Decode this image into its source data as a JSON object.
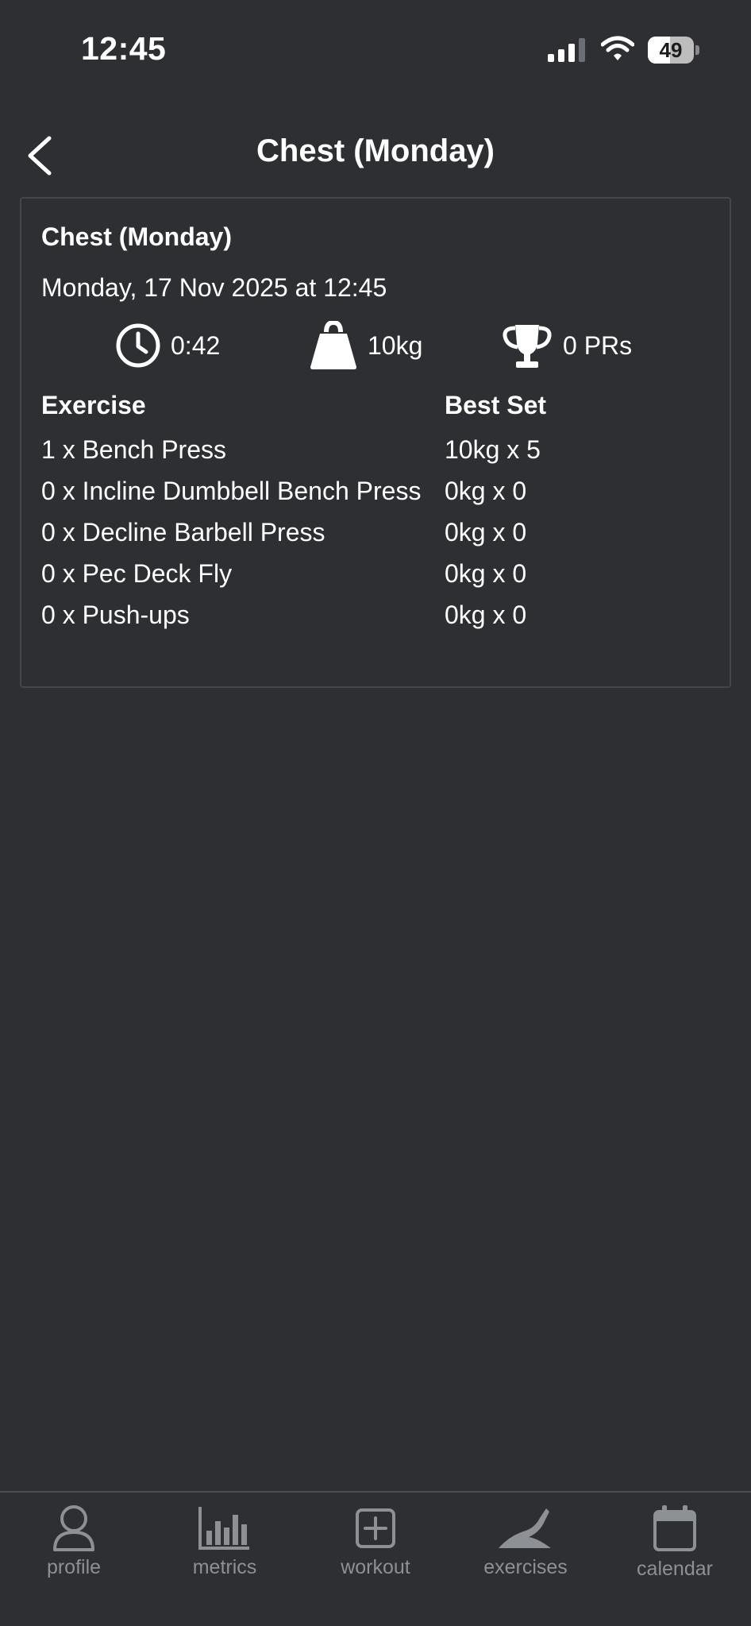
{
  "status_bar": {
    "time": "12:45",
    "battery_level": "49",
    "battery_fraction": 0.49,
    "icons": [
      "signal-icon",
      "wifi-icon",
      "battery-icon"
    ]
  },
  "header": {
    "title": "Chest (Monday)",
    "back_icon": "chevron-left-icon"
  },
  "workout": {
    "title": "Chest (Monday)",
    "date": "Monday, 17 Nov 2025 at 12:45",
    "stats": {
      "duration": "0:42",
      "volume": "10kg",
      "prs": "0 PRs"
    },
    "stat_icons": [
      "clock-icon",
      "weight-icon",
      "trophy-icon"
    ],
    "table": {
      "headers": {
        "exercise": "Exercise",
        "best_set": "Best Set"
      },
      "rows": [
        {
          "exercise": "1 x Bench Press",
          "best_set": "10kg x 5"
        },
        {
          "exercise": "0 x Incline Dumbbell Bench Press",
          "best_set": "0kg x 0"
        },
        {
          "exercise": "0 x Decline Barbell Press",
          "best_set": "0kg x 0"
        },
        {
          "exercise": "0 x Pec Deck Fly",
          "best_set": "0kg x 0"
        },
        {
          "exercise": "0 x Push-ups",
          "best_set": "0kg x 0"
        }
      ]
    }
  },
  "tab_bar": {
    "tabs": [
      {
        "label": "profile",
        "icon": "profile-icon"
      },
      {
        "label": "metrics",
        "icon": "metrics-icon"
      },
      {
        "label": "workout",
        "icon": "plus-square-icon"
      },
      {
        "label": "exercises",
        "icon": "exercises-icon"
      },
      {
        "label": "calendar",
        "icon": "calendar-icon"
      }
    ]
  },
  "colors": {
    "background": "#2d2f32",
    "text": "#ffffff",
    "muted": "#8d9094",
    "border": "#43464a"
  }
}
